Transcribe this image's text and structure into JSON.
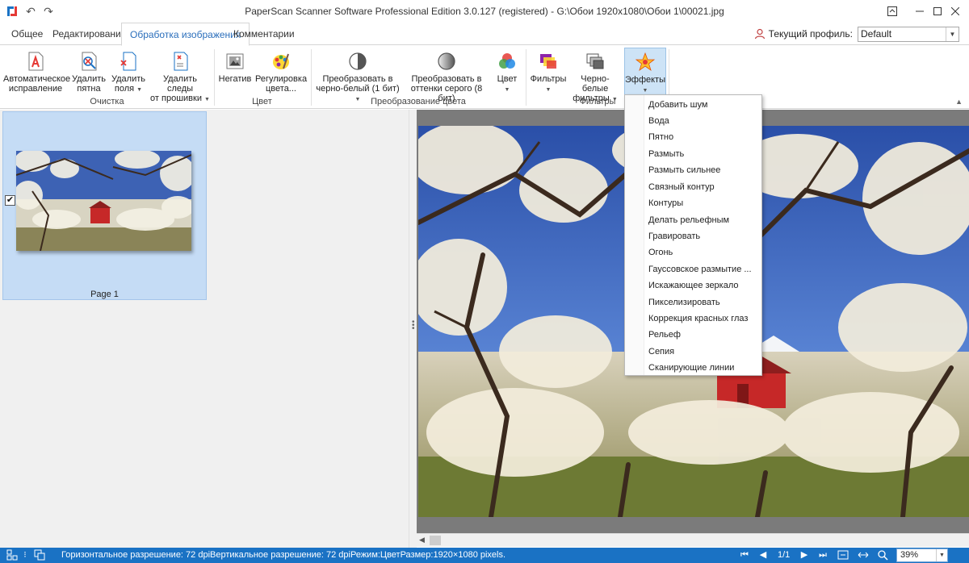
{
  "window": {
    "title": "PaperScan Scanner Software Professional Edition 3.0.127 (registered) - G:\\Обои 1920x1080\\Обои 1\\00021.jpg"
  },
  "tabs": [
    {
      "label": "Общее",
      "active": false
    },
    {
      "label": "Редактирование",
      "active": false
    },
    {
      "label": "Обработка изображения",
      "active": true
    },
    {
      "label": "Комментарии",
      "active": false
    }
  ],
  "profile": {
    "label": "Текущий профиль:",
    "value": "Default"
  },
  "ribbon": {
    "groups": [
      {
        "label": "Очистка"
      },
      {
        "label": "Цвет"
      },
      {
        "label": "Преобразование цвета"
      },
      {
        "label": "Фильтры"
      }
    ],
    "buttons": {
      "auto_fix": {
        "line1": "Автоматическое",
        "line2": "исправление"
      },
      "remove_spots": {
        "line1": "Удалить",
        "line2": "пятна"
      },
      "remove_margins": {
        "line1": "Удалить",
        "line2": "поля"
      },
      "remove_staples": {
        "line1": "Удалить следы",
        "line2": "от прошивки"
      },
      "negative": {
        "line1": "Негатив"
      },
      "color_adjust": {
        "line1": "Регулировка",
        "line2": "цвета..."
      },
      "to_bw": {
        "line1": "Преобразовать в",
        "line2": "черно-белый (1 бит)"
      },
      "to_gray": {
        "line1": "Преобразовать в",
        "line2": "оттенки серого (8 бит)"
      },
      "color": {
        "line1": "Цвет"
      },
      "filters": {
        "line1": "Фильтры"
      },
      "bw_filters": {
        "line1": "Черно-белые",
        "line2": "фильтры"
      },
      "effects": {
        "line1": "Эффекты"
      }
    }
  },
  "effects_menu": {
    "items": [
      "Добавить шум",
      "Вода",
      "Пятно",
      "Размыть",
      "Размыть сильнее",
      "Связный контур",
      "Контуры",
      "Делать рельефным",
      "Гравировать",
      "Огонь",
      "Гауссовское размытие ...",
      "Искажающее зеркало",
      "Пикселизировать",
      "Коррекция красных глаз",
      "Рельеф",
      "Сепия",
      "Сканирующие линии"
    ]
  },
  "thumbnails": [
    {
      "label": "Page 1",
      "checked": true
    }
  ],
  "statusbar": {
    "info": "Горизонтальное разрешение: 72 dpiВертикальное разрешение: 72 dpiРежим:ЦветРазмер:1920×1080 pixels.",
    "page": "1/1",
    "zoom": "39%"
  },
  "colors": {
    "accent": "#2a6ebb",
    "statusbar": "#1a72c4",
    "selection": "#cde3f6"
  }
}
